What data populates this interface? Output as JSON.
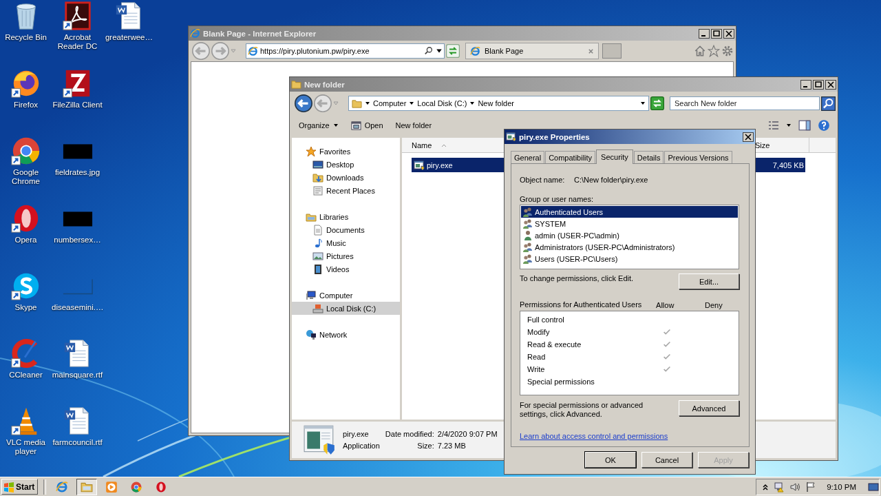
{
  "desktop": {
    "icons": [
      {
        "label": "Recycle Bin",
        "kind": "recycle",
        "shortcut": false
      },
      {
        "label": "Firefox",
        "kind": "firefox",
        "shortcut": true
      },
      {
        "label": "Google Chrome",
        "kind": "chrome",
        "shortcut": true
      },
      {
        "label": "Opera",
        "kind": "opera",
        "shortcut": true
      },
      {
        "label": "Skype",
        "kind": "skype",
        "shortcut": true
      },
      {
        "label": "CCleaner",
        "kind": "ccleaner",
        "shortcut": true
      },
      {
        "label": "VLC media player",
        "kind": "vlc",
        "shortcut": true
      },
      {
        "label": "Acrobat Reader DC",
        "kind": "pdf",
        "shortcut": true
      },
      {
        "label": "FileZilla Client",
        "kind": "filezilla",
        "shortcut": true
      },
      {
        "label": "fieldrates.jpg",
        "shortcut": false
      },
      {
        "label": "numbersex…",
        "shortcut": false
      },
      {
        "label": "diseasemini.…",
        "kind": "image_light",
        "shortcut": false
      },
      {
        "label": "mainsquare.rtf",
        "kind": "word",
        "shortcut": false
      },
      {
        "label": "farmcouncil.rtf",
        "kind": "word",
        "shortcut": false
      },
      {
        "label": "greaterwee…",
        "kind": "word",
        "shortcut": false
      }
    ]
  },
  "browser_window": {
    "title": "Blank Page - Internet Explorer",
    "active": false,
    "address": "https://piry.plutonium.pw/piry.exe",
    "tab": "Blank Page"
  },
  "explorer_window": {
    "title": "New folder",
    "active": false,
    "breadcrumb": [
      "Computer",
      "Local Disk (C:)",
      "New folder"
    ],
    "search": {
      "placeholder": "Search New folder"
    },
    "commands": [
      {
        "label": "Organize",
        "kind": "menu"
      },
      {
        "label": "Open",
        "kind": "open"
      },
      {
        "label": "New folder",
        "kind": "plain"
      }
    ],
    "nav": [
      {
        "label": "Favorites",
        "kind": "favorites",
        "selected": false,
        "children": [
          {
            "label": "Desktop",
            "kind": "desktop",
            "selected": false
          },
          {
            "label": "Downloads",
            "kind": "downloads",
            "selected": false
          },
          {
            "label": "Recent Places",
            "kind": "recent",
            "selected": false
          }
        ]
      },
      {
        "label": "Libraries",
        "kind": "libraries",
        "selected": false,
        "children": [
          {
            "label": "Documents",
            "kind": "documents",
            "selected": false
          },
          {
            "label": "Music",
            "kind": "music",
            "selected": false
          },
          {
            "label": "Pictures",
            "kind": "pictures",
            "selected": false
          },
          {
            "label": "Videos",
            "kind": "videos",
            "selected": false
          }
        ]
      },
      {
        "label": "Computer",
        "kind": "computer",
        "selected": false,
        "children": [
          {
            "label": "Local Disk (C:)",
            "kind": "disk",
            "selected": true
          }
        ]
      },
      {
        "label": "Network",
        "kind": "network",
        "selected": false
      }
    ],
    "columns": [
      "Name",
      "Size"
    ],
    "files": [
      {
        "name": "piry.exe",
        "size": "7,405 KB",
        "selected": true
      }
    ],
    "details": {
      "name": "piry.exe",
      "type": "Application",
      "fields": [
        {
          "label": "Date modified:",
          "value": "2/4/2020 9:07 PM"
        },
        {
          "label": "Size:",
          "value": "7.23 MB"
        }
      ]
    }
  },
  "properties_dialog": {
    "title": "piry.exe Properties",
    "active": true,
    "tabs": [
      {
        "label": "General",
        "selected": false
      },
      {
        "label": "Compatibility",
        "selected": false
      },
      {
        "label": "Security",
        "selected": true
      },
      {
        "label": "Details",
        "selected": false
      },
      {
        "label": "Previous Versions",
        "selected": false
      }
    ],
    "object_name_label": "Object name:",
    "object_name": "C:\\New folder\\piry.exe",
    "group_label": "Group or user names:",
    "principals": [
      {
        "name": "Authenticated Users",
        "kind": "group",
        "selected": true
      },
      {
        "name": "SYSTEM",
        "kind": "group",
        "selected": false
      },
      {
        "name": "admin (USER-PC\\admin)",
        "kind": "user",
        "selected": false
      },
      {
        "name": "Administrators (USER-PC\\Administrators)",
        "kind": "group",
        "selected": false
      },
      {
        "name": "Users (USER-PC\\Users)",
        "kind": "group",
        "selected": false
      }
    ],
    "edit_hint": "To change permissions, click Edit.",
    "edit_button": "Edit...",
    "permissions_label": "Permissions for Authenticated Users",
    "allow_header": "Allow",
    "deny_header": "Deny",
    "permissions": [
      {
        "name": "Full control",
        "allow": false,
        "deny": false
      },
      {
        "name": "Modify",
        "allow": true,
        "deny": false
      },
      {
        "name": "Read & execute",
        "allow": true,
        "deny": false
      },
      {
        "name": "Read",
        "allow": true,
        "deny": false
      },
      {
        "name": "Write",
        "allow": true,
        "deny": false
      },
      {
        "name": "Special permissions",
        "allow": false,
        "deny": false
      }
    ],
    "advanced_hint": "For special permissions or advanced settings, click Advanced.",
    "advanced_button": "Advanced",
    "help_link": "Learn about access control and permissions",
    "buttons": [
      {
        "label": "OK",
        "kind": "default",
        "disabled": false
      },
      {
        "label": "Cancel",
        "kind": "normal",
        "disabled": false
      },
      {
        "label": "Apply",
        "kind": "normal",
        "disabled": true
      }
    ]
  },
  "taskbar": {
    "start": "Start",
    "apps": [
      {
        "kind": "ie",
        "active": false
      },
      {
        "kind": "explorer",
        "active": true
      },
      {
        "kind": "media",
        "active": false
      },
      {
        "kind": "chrome",
        "active": false
      },
      {
        "kind": "opera",
        "active": false
      }
    ],
    "clock": "9:10 PM"
  }
}
